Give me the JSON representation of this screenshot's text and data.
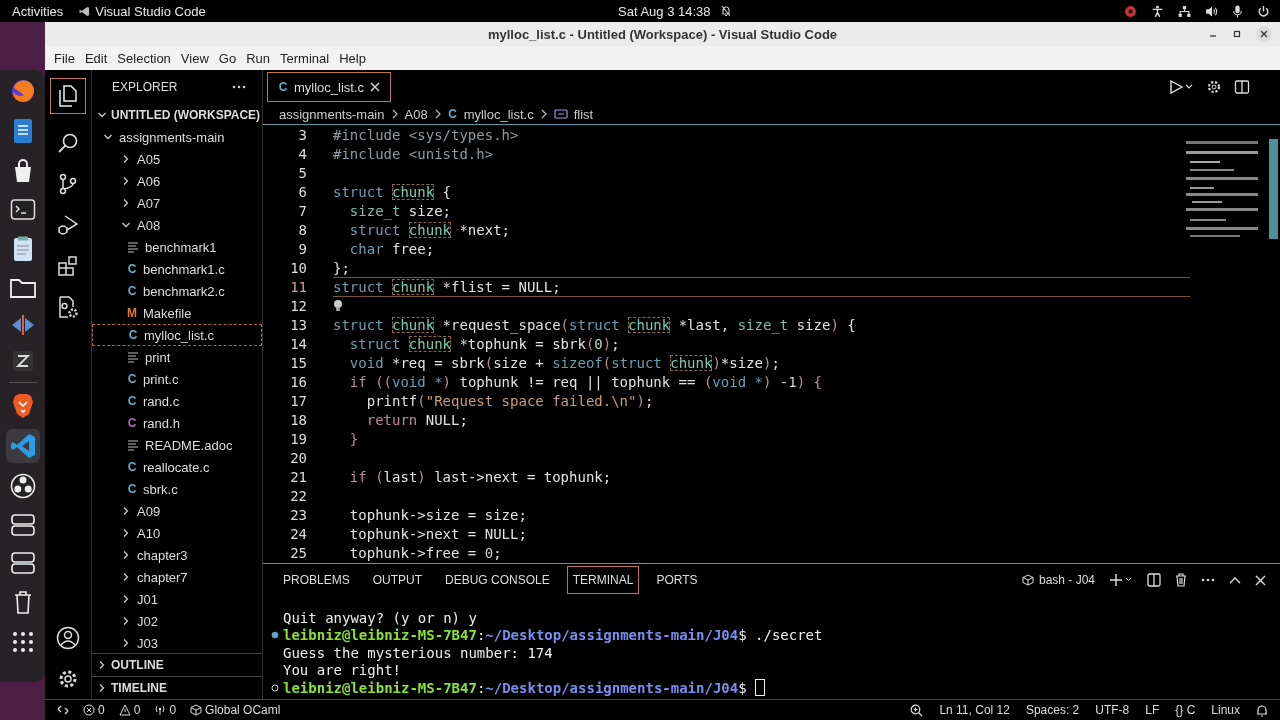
{
  "top_bar": {
    "activities": "Activities",
    "app_name": "Visual Studio Code",
    "clock": "Sat Aug 3  14:38"
  },
  "window": {
    "title": "mylloc_list.c - Untitled (Workspace) - Visual Studio Code"
  },
  "menu": [
    "File",
    "Edit",
    "Selection",
    "View",
    "Go",
    "Run",
    "Terminal",
    "Help"
  ],
  "explorer": {
    "title": "EXPLORER",
    "workspace": {
      "label": "UNTITLED (WORKSPACE)",
      "expanded": true
    },
    "tree": [
      {
        "kind": "folder",
        "label": "assignments-main",
        "expanded": true,
        "children": [
          {
            "kind": "folder",
            "label": "A05",
            "expanded": false
          },
          {
            "kind": "folder",
            "label": "A06",
            "expanded": false
          },
          {
            "kind": "folder",
            "label": "A07",
            "expanded": false
          },
          {
            "kind": "folder",
            "label": "A08",
            "expanded": true,
            "children": [
              {
                "kind": "file",
                "label": "benchmark1",
                "selected": false
              },
              {
                "kind": "file",
                "label": "benchmark1.c",
                "badge": "C",
                "color": "#6aa9c9",
                "selected": false
              },
              {
                "kind": "file",
                "label": "benchmark2.c",
                "badge": "C",
                "color": "#6aa9c9",
                "selected": false
              },
              {
                "kind": "file",
                "label": "Makefile",
                "badge": "M",
                "color": "#e37933",
                "selected": false
              },
              {
                "kind": "file",
                "label": "mylloc_list.c",
                "badge": "C",
                "color": "#6aa9c9",
                "selected": true
              },
              {
                "kind": "file",
                "label": "print",
                "selected": false
              },
              {
                "kind": "file",
                "label": "print.c",
                "badge": "C",
                "color": "#6aa9c9",
                "selected": false
              },
              {
                "kind": "file",
                "label": "rand.c",
                "badge": "C",
                "color": "#6aa9c9",
                "selected": false
              },
              {
                "kind": "file",
                "label": "rand.h",
                "badge": "C",
                "color": "#a074c4",
                "selected": false
              },
              {
                "kind": "file",
                "label": "README.adoc",
                "selected": false
              },
              {
                "kind": "file",
                "label": "reallocate.c",
                "badge": "C",
                "color": "#6aa9c9",
                "selected": false
              },
              {
                "kind": "file",
                "label": "sbrk.c",
                "badge": "C",
                "color": "#6aa9c9",
                "selected": false
              }
            ]
          },
          {
            "kind": "folder",
            "label": "A09",
            "expanded": false
          },
          {
            "kind": "folder",
            "label": "A10",
            "expanded": false
          },
          {
            "kind": "folder",
            "label": "chapter3",
            "expanded": false
          },
          {
            "kind": "folder",
            "label": "chapter7",
            "expanded": false
          },
          {
            "kind": "folder",
            "label": "J01",
            "expanded": false
          },
          {
            "kind": "folder",
            "label": "J02",
            "expanded": false
          },
          {
            "kind": "folder",
            "label": "J03",
            "expanded": false
          }
        ]
      }
    ],
    "sections": [
      {
        "label": "OUTLINE",
        "expanded": false
      },
      {
        "label": "TIMELINE",
        "expanded": false
      }
    ]
  },
  "editor_tabs": [
    {
      "label": "mylloc_list.c",
      "badge": "C",
      "selected": true
    }
  ],
  "breadcrumbs": [
    {
      "kind": "folder",
      "label": "assignments-main"
    },
    {
      "kind": "folder",
      "label": "A08"
    },
    {
      "kind": "file",
      "badge": "C",
      "label": "mylloc_list.c"
    },
    {
      "kind": "symbol",
      "label": "flist"
    }
  ],
  "code": [
    {
      "number": "3",
      "current": false,
      "hint": false,
      "tokens": [
        {
          "kind": "pre",
          "text": "#include <sys/types.h>"
        }
      ]
    },
    {
      "number": "4",
      "current": false,
      "hint": false,
      "tokens": [
        {
          "kind": "pre",
          "text": "#include <unistd.h>"
        }
      ]
    },
    {
      "number": "5",
      "current": false,
      "hint": false
    },
    {
      "number": "6",
      "current": false,
      "hint": false,
      "tokens": [
        {
          "kind": "kw",
          "text": "struct "
        },
        {
          "kind": "ref",
          "text": "chunk"
        },
        {
          "kind": "id",
          "text": " {"
        }
      ]
    },
    {
      "number": "7",
      "current": false,
      "hint": false,
      "tokens": [
        {
          "kind": "type",
          "text": "  size_t"
        },
        {
          "kind": "id",
          "text": " size;"
        }
      ]
    },
    {
      "number": "8",
      "current": false,
      "hint": false,
      "tokens": [
        {
          "kind": "kw",
          "text": "  struct "
        },
        {
          "kind": "ref",
          "text": "chunk"
        },
        {
          "kind": "id",
          "text": " *next;"
        }
      ]
    },
    {
      "number": "9",
      "current": false,
      "hint": false,
      "tokens": [
        {
          "kind": "kw",
          "text": "  char"
        },
        {
          "kind": "id",
          "text": " free;"
        }
      ]
    },
    {
      "number": "10",
      "current": false,
      "hint": false,
      "tokens": [
        {
          "kind": "id",
          "text": "};"
        }
      ]
    },
    {
      "number": "11",
      "current": true,
      "hint": false,
      "tokens": [
        {
          "kind": "kw",
          "text": "struct "
        },
        {
          "kind": "ref",
          "text": "chunk"
        },
        {
          "kind": "id",
          "text": " *flist = NULL;"
        }
      ]
    },
    {
      "number": "12",
      "current": false,
      "hint": true
    },
    {
      "number": "13",
      "current": false,
      "hint": false,
      "tokens": [
        {
          "kind": "kw",
          "text": "struct "
        },
        {
          "kind": "ref",
          "text": "chunk"
        },
        {
          "kind": "id",
          "text": " *request_space"
        },
        {
          "kind": "paren",
          "text": "("
        },
        {
          "kind": "kw",
          "text": "struct "
        },
        {
          "kind": "ref",
          "text": "chunk"
        },
        {
          "kind": "id",
          "text": " *last, "
        },
        {
          "kind": "type",
          "text": "size_t"
        },
        {
          "kind": "id",
          "text": " size"
        },
        {
          "kind": "paren",
          "text": ")"
        },
        {
          "kind": "id",
          "text": " {"
        }
      ]
    },
    {
      "number": "14",
      "current": false,
      "hint": false,
      "tokens": [
        {
          "kind": "kw",
          "text": "  struct "
        },
        {
          "kind": "ref",
          "text": "chunk"
        },
        {
          "kind": "id",
          "text": " *tophunk = sbrk"
        },
        {
          "kind": "paren",
          "text": "("
        },
        {
          "kind": "num",
          "text": "0"
        },
        {
          "kind": "paren",
          "text": ")"
        },
        {
          "kind": "id",
          "text": ";"
        }
      ]
    },
    {
      "number": "15",
      "current": false,
      "hint": false,
      "tokens": [
        {
          "kind": "kw",
          "text": "  void"
        },
        {
          "kind": "id",
          "text": " *req = sbrk"
        },
        {
          "kind": "paren",
          "text": "("
        },
        {
          "kind": "id",
          "text": "size + "
        },
        {
          "kind": "kw",
          "text": "sizeof"
        },
        {
          "kind": "paren",
          "text": "("
        },
        {
          "kind": "kw",
          "text": "struct "
        },
        {
          "kind": "ref",
          "text": "chunk"
        },
        {
          "kind": "paren",
          "text": ")"
        },
        {
          "kind": "id",
          "text": "*size"
        },
        {
          "kind": "paren",
          "text": ")"
        },
        {
          "kind": "id",
          "text": ";"
        }
      ]
    },
    {
      "number": "16",
      "current": false,
      "hint": false,
      "tokens": [
        {
          "kind": "ctrl",
          "text": "  if "
        },
        {
          "kind": "paren",
          "text": "(("
        },
        {
          "kind": "kw",
          "text": "void *"
        },
        {
          "kind": "paren",
          "text": ")"
        },
        {
          "kind": "id",
          "text": " tophunk != req || tophunk == "
        },
        {
          "kind": "paren",
          "text": "("
        },
        {
          "kind": "kw",
          "text": "void *"
        },
        {
          "kind": "paren",
          "text": ")"
        },
        {
          "kind": "num",
          "text": " -1"
        },
        {
          "kind": "paren",
          "text": ")"
        },
        {
          "kind": "paren",
          "text": " {"
        }
      ]
    },
    {
      "number": "17",
      "current": false,
      "hint": false,
      "tokens": [
        {
          "kind": "id",
          "text": "    printf"
        },
        {
          "kind": "paren",
          "text": "("
        },
        {
          "kind": "str",
          "text": "\"Request space failed.\\n\""
        },
        {
          "kind": "paren",
          "text": ")"
        },
        {
          "kind": "id",
          "text": ";"
        }
      ]
    },
    {
      "number": "18",
      "current": false,
      "hint": false,
      "tokens": [
        {
          "kind": "ctrl",
          "text": "    return"
        },
        {
          "kind": "id",
          "text": " NULL;"
        }
      ]
    },
    {
      "number": "19",
      "current": false,
      "hint": false,
      "tokens": [
        {
          "kind": "paren",
          "text": "  }"
        }
      ]
    },
    {
      "number": "20",
      "current": false,
      "hint": false
    },
    {
      "number": "21",
      "current": false,
      "hint": false,
      "tokens": [
        {
          "kind": "ctrl",
          "text": "  if "
        },
        {
          "kind": "paren",
          "text": "("
        },
        {
          "kind": "id",
          "text": "last"
        },
        {
          "kind": "paren",
          "text": ")"
        },
        {
          "kind": "id",
          "text": " last->next = tophunk;"
        }
      ]
    },
    {
      "number": "22",
      "current": false,
      "hint": false
    },
    {
      "number": "23",
      "current": false,
      "hint": false,
      "tokens": [
        {
          "kind": "id",
          "text": "  tophunk->size = size;"
        }
      ]
    },
    {
      "number": "24",
      "current": false,
      "hint": false,
      "tokens": [
        {
          "kind": "id",
          "text": "  tophunk->next = NULL;"
        }
      ]
    },
    {
      "number": "25",
      "current": false,
      "hint": false,
      "tokens": [
        {
          "kind": "id",
          "text": "  tophunk->free = "
        },
        {
          "kind": "num",
          "text": "0"
        },
        {
          "kind": "id",
          "text": ";"
        }
      ]
    }
  ],
  "panel_tabs": [
    {
      "label": "PROBLEMS",
      "selected": false
    },
    {
      "label": "OUTPUT",
      "selected": false
    },
    {
      "label": "DEBUG CONSOLE",
      "selected": false
    },
    {
      "label": "TERMINAL",
      "selected": true
    },
    {
      "label": "PORTS",
      "selected": false
    }
  ],
  "terminal_name": "bash - J04",
  "terminal": [
    {
      "kind": "output",
      "text": "Quit anyway? (y or n) y"
    },
    {
      "kind": "prompt",
      "done": true,
      "user": "leibniz@leibniz-MS-7B47",
      "sep": ":",
      "path": "~/Desktop/assignments-main/J04",
      "command": "$ ./secret",
      "cursor": false
    },
    {
      "kind": "output",
      "text": "Guess the mysterious number: 174"
    },
    {
      "kind": "output",
      "text": "You are right!"
    },
    {
      "kind": "prompt",
      "done": false,
      "user": "leibniz@leibniz-MS-7B47",
      "sep": ":",
      "path": "~/Desktop/assignments-main/J04",
      "command": "$",
      "cursor": true
    }
  ],
  "status_left": [
    {
      "kind": "remote"
    },
    {
      "kind": "errors",
      "text": "0"
    },
    {
      "kind": "warnings",
      "text": "0"
    },
    {
      "kind": "ports",
      "text": "0"
    },
    {
      "kind": "env",
      "text": "Global OCaml"
    }
  ],
  "status_right": [
    {
      "kind": "zoom"
    },
    {
      "kind": "text",
      "text": "Ln 11, Col 12"
    },
    {
      "kind": "text",
      "text": "Spaces: 2"
    },
    {
      "kind": "text",
      "text": "UTF-8"
    },
    {
      "kind": "text",
      "text": "LF"
    },
    {
      "kind": "text",
      "text": "{} C"
    },
    {
      "kind": "text",
      "text": "Linux"
    },
    {
      "kind": "bell"
    }
  ]
}
